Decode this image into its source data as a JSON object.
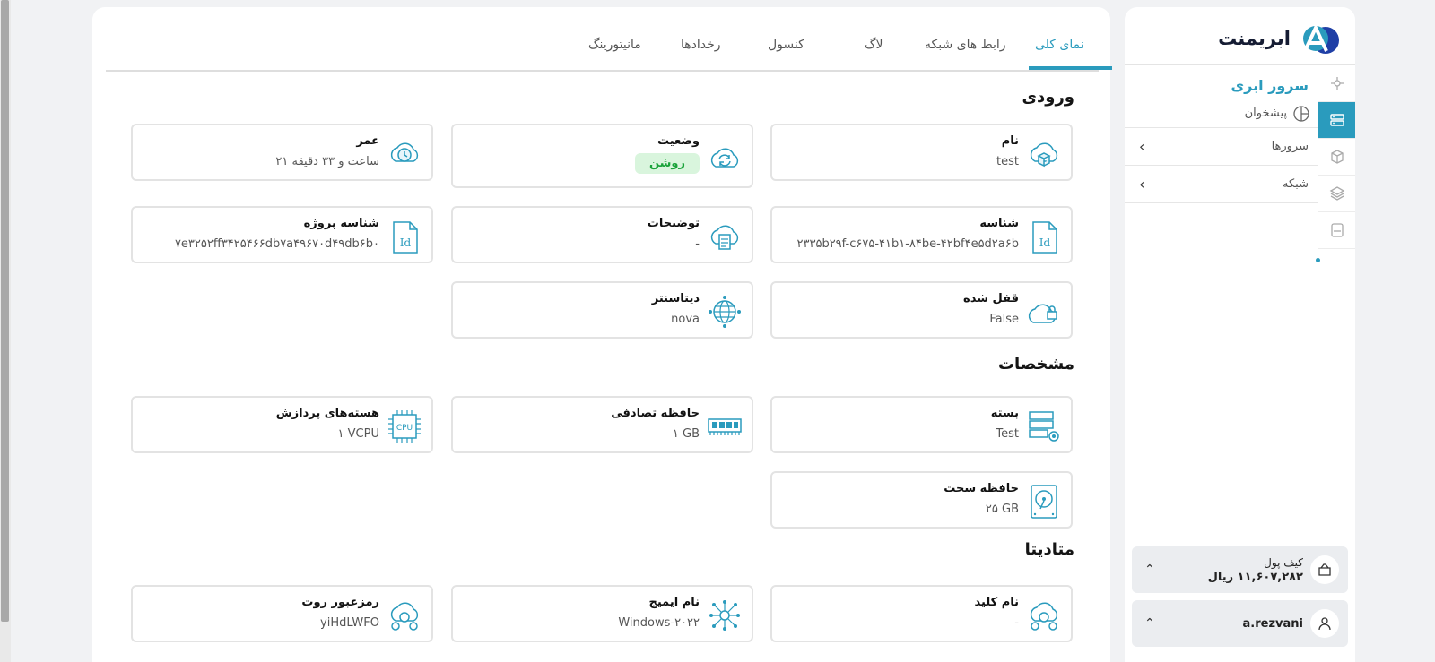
{
  "brand": {
    "name": "ابریمنت"
  },
  "sidebar": {
    "section_title": "سرور ابری",
    "dashboard": "پیشخوان",
    "items": [
      {
        "label": "سرورها"
      },
      {
        "label": "شبکه"
      }
    ],
    "wallet": {
      "label": "کیف پول",
      "amount": "۱۱,۶۰۷,۲۸۲ ریال"
    },
    "user": {
      "name": "a.rezvani"
    }
  },
  "tabs": [
    {
      "label": "نمای کلی",
      "active": true
    },
    {
      "label": "رابط های شبکه"
    },
    {
      "label": "لاگ"
    },
    {
      "label": "کنسول"
    },
    {
      "label": "رخدادها"
    },
    {
      "label": "مانیتورینگ"
    }
  ],
  "sections": {
    "input": {
      "title": "ورودی"
    },
    "specs": {
      "title": "مشخصات"
    },
    "metadata": {
      "title": "متادیتا"
    }
  },
  "fields": {
    "name": {
      "label": "نام",
      "value": "test"
    },
    "status": {
      "label": "وضعیت",
      "value": "روشن"
    },
    "age": {
      "label": "عمر",
      "value": "۲۱ ساعت و ۳۳ دقیقه"
    },
    "id": {
      "label": "شناسه",
      "value": "۲۳۳۵b۲۹f-c۶۷۵-۴۱b۱-۸۴be-۴۲bf۴e۵d۲a۶b"
    },
    "description": {
      "label": "توضیحات",
      "value": "-"
    },
    "project_id": {
      "label": "شناسه پروژه",
      "value": "۷e۳۲۵۲ff۳۴۲۵۴۶۶db۷a۴۹۶۷۰d۴۹db۶b۰"
    },
    "locked": {
      "label": "قفل شده",
      "value": "False"
    },
    "datacenter": {
      "label": "دیتاسنتر",
      "value": "nova"
    },
    "package": {
      "label": "بسته",
      "value": "Test"
    },
    "ram": {
      "label": "حافظه تصادفی",
      "value": "۱ GB"
    },
    "cpu": {
      "label": "هسته‌های پردازش",
      "value": "۱ VCPU"
    },
    "disk": {
      "label": "حافظه سخت",
      "value": "۲۵ GB"
    },
    "key_name": {
      "label": "نام کلید",
      "value": "-"
    },
    "image_name": {
      "label": "نام ایمیج",
      "value": "Windows-۲۰۲۲"
    },
    "root_password": {
      "label": "رمزعبور روت",
      "value": "yiHdLWFO"
    }
  },
  "colors": {
    "accent": "#2a9bbd",
    "status_on_bg": "#d9f5dd",
    "status_on_text": "#1aa33a"
  }
}
